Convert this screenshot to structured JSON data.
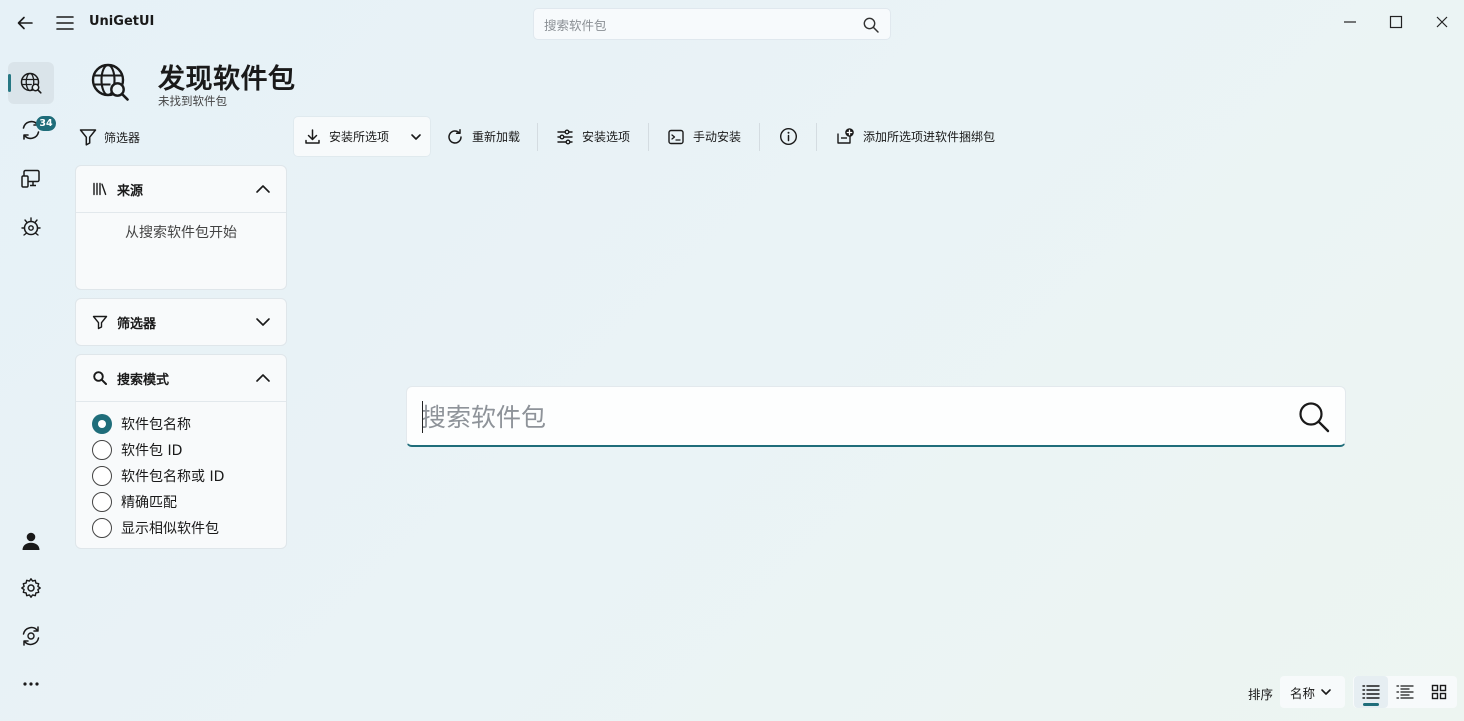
{
  "app": {
    "title": "UniGetUI"
  },
  "topbar": {
    "search_placeholder": "搜索软件包"
  },
  "nav": {
    "updates_badge": "34"
  },
  "page": {
    "title": "发现软件包",
    "subtitle": "未找到软件包"
  },
  "filter_toggle_label": "筛选器",
  "toolbar": {
    "install_selected": "安装所选项",
    "reload": "重新加载",
    "install_options": "安装选项",
    "manual_install": "手动安装",
    "add_to_bundle": "添加所选项进软件捆绑包"
  },
  "sources_panel": {
    "title": "来源",
    "empty_text": "从搜索软件包开始"
  },
  "filters_panel": {
    "title": "筛选器"
  },
  "search_mode_panel": {
    "title": "搜索模式",
    "options": [
      "软件包名称",
      "软件包 ID",
      "软件包名称或 ID",
      "精确匹配",
      "显示相似软件包"
    ],
    "selected_index": 0
  },
  "main_search": {
    "placeholder": "搜索软件包"
  },
  "bottom": {
    "sort_label": "排序",
    "sort_value": "名称"
  },
  "colors": {
    "accent": "#1f6d7a"
  },
  "icons": {
    "nav": [
      "globe-search-icon",
      "sync-icon",
      "desktop-icon",
      "settings-bug-icon",
      "person-icon",
      "gear-icon",
      "help-sync-icon",
      "more-icon"
    ],
    "toolbar": [
      "download-icon",
      "reload-icon",
      "sliders-icon",
      "terminal-icon",
      "info-icon",
      "bundle-add-icon"
    ]
  }
}
